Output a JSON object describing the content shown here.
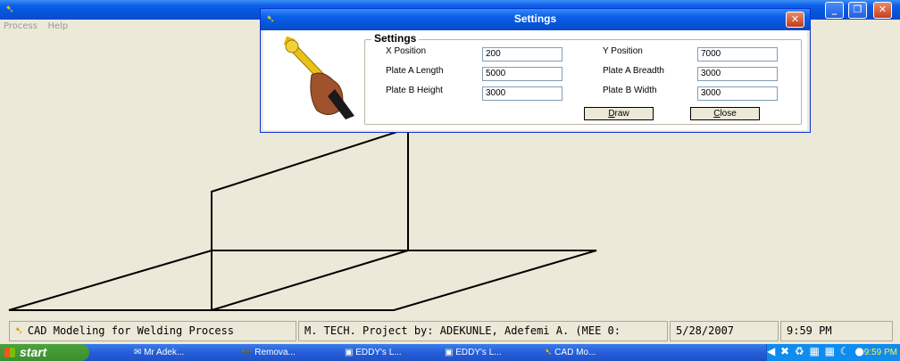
{
  "menu": [
    "Process",
    "Help"
  ],
  "dialog": {
    "title": "Settings",
    "group_label": "Settings",
    "fields": [
      {
        "label": "X Position",
        "value": "200"
      },
      {
        "label": "Y Position",
        "value": "7000"
      },
      {
        "label": "Plate A Length",
        "value": "5000"
      },
      {
        "label": "Plate A Breadth",
        "value": "3000"
      },
      {
        "label": "Plate B Height",
        "value": "3000"
      },
      {
        "label": "Plate B Width",
        "value": "3000"
      }
    ],
    "draw_button": {
      "first": "D",
      "rest": "raw"
    },
    "close_button": {
      "first": "C",
      "rest": "lose"
    }
  },
  "status": {
    "app": "CAD Modeling for Welding Process",
    "project": "M. TECH. Project by: ADEKUNLE, Adefemi A. (MEE 0:",
    "date": "5/28/2007",
    "time": "9:59 PM"
  },
  "taskbar": {
    "start": "start",
    "tasks": [
      "Mr Adek...",
      "Remova...",
      "EDDY's L...",
      "EDDY's L...",
      "CAD Mo..."
    ],
    "clock": "9:59 PM"
  },
  "icons": {
    "app": "welding-torch-icon",
    "dialog": "wrench-hand-icon"
  },
  "colors": {
    "titlebar": "#0554d6",
    "close": "#c6401e",
    "canvas": "#ece9d8",
    "clock_text": "#ffee55"
  }
}
